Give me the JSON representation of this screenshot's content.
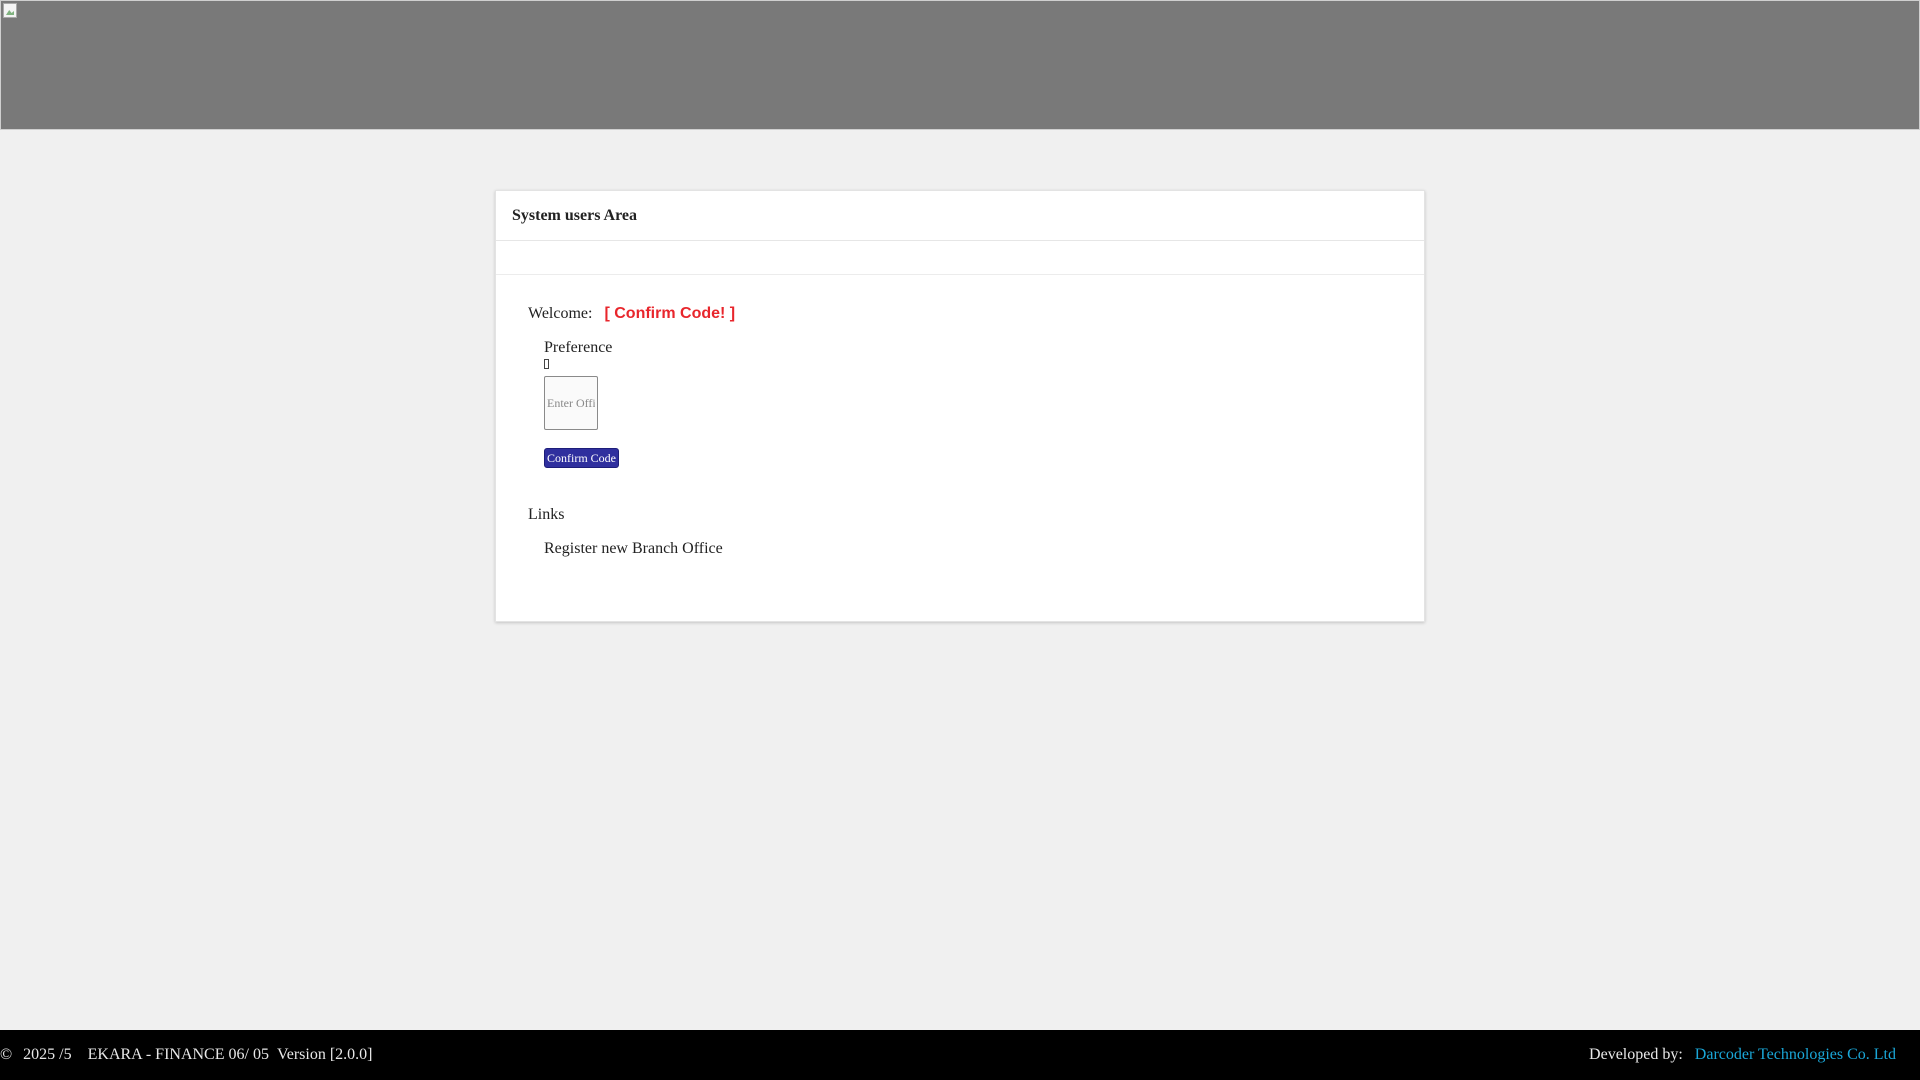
{
  "header": {
    "banner_icon": "broken-image-icon"
  },
  "panel": {
    "title": "System users Area",
    "welcome_label": "Welcome:",
    "welcome_status": "[ Confirm Code! ]",
    "preference_label": "Preference",
    "code_input": {
      "value": "",
      "placeholder": "Enter Office Code"
    },
    "confirm_button_label": "Confirm Code",
    "links_heading": "Links",
    "register_link_label": "Register new Branch Office"
  },
  "footer": {
    "copyright_symbol": "©",
    "year": "2025 /5",
    "app_name": "EKARA - FINANCE 06/ 05",
    "version": "Version [2.0.0]",
    "developed_by_label": "Developed by:",
    "company_name": "Darcoder Technologies Co. Ltd"
  },
  "colors": {
    "banner": "#797979",
    "status_red": "#e8262c",
    "button": "#2f2f9e",
    "footer_bg": "#000000",
    "company_link": "#1aa7d8"
  }
}
